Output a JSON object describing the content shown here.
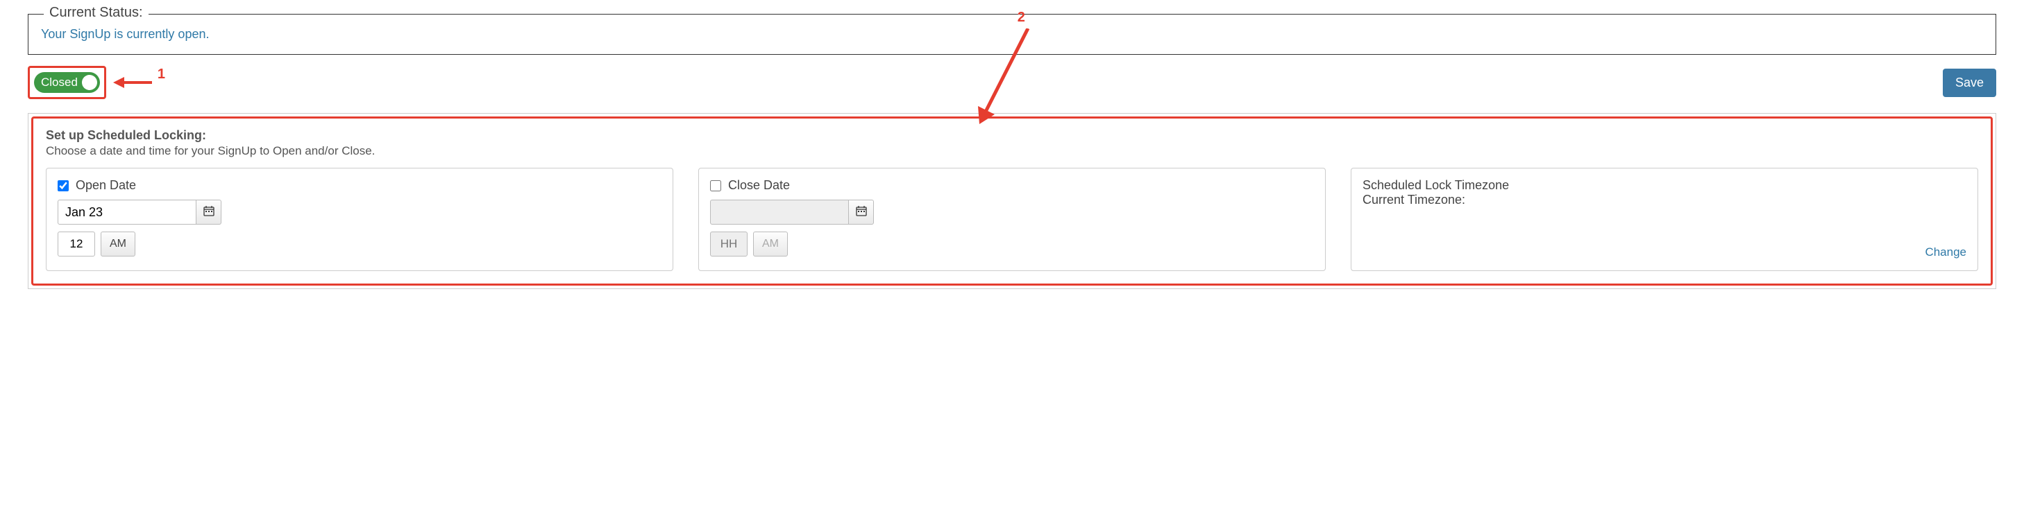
{
  "status": {
    "legend": "Current Status:",
    "message": "Your SignUp is currently open."
  },
  "toggle": {
    "label": "Closed"
  },
  "annotations": {
    "one": "1",
    "two": "2"
  },
  "save": {
    "label": "Save"
  },
  "schedule": {
    "title": "Set up Scheduled Locking:",
    "subtitle": "Choose a date and time for your SignUp to Open and/or Close.",
    "open": {
      "label": "Open Date",
      "checked": true,
      "date": "Jan 23",
      "hour": "12",
      "ampm": "AM"
    },
    "close": {
      "label": "Close Date",
      "checked": false,
      "date": "",
      "hour_placeholder": "HH",
      "ampm": "AM"
    },
    "tz": {
      "line1": "Scheduled Lock Timezone",
      "line2": "Current Timezone:",
      "change": "Change"
    }
  }
}
